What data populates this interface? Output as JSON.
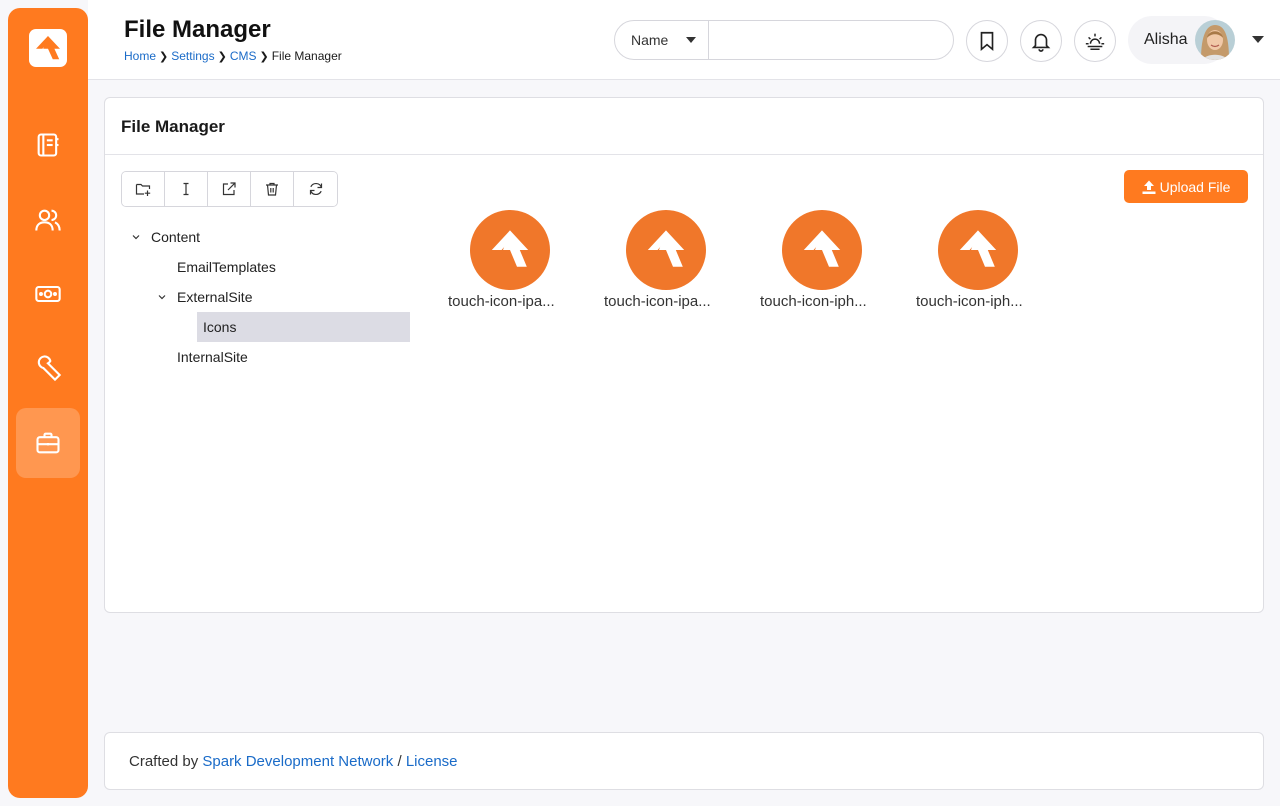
{
  "header": {
    "title": "File Manager",
    "breadcrumb": [
      "Home",
      "Settings",
      "CMS",
      "File Manager"
    ],
    "search": {
      "select_value": "Name",
      "value": "",
      "placeholder": ""
    },
    "user": {
      "name": "Alisha"
    }
  },
  "sidebar": {
    "items": [
      {
        "icon": "book-icon"
      },
      {
        "icon": "people-icon"
      },
      {
        "icon": "money-icon"
      },
      {
        "icon": "wrench-icon"
      },
      {
        "icon": "briefcase-icon",
        "active": true
      }
    ]
  },
  "card": {
    "title": "File Manager",
    "upload_label": "Upload File",
    "toolbar": [
      "new-folder-icon",
      "rename-icon",
      "open-icon",
      "trash-icon",
      "refresh-icon"
    ]
  },
  "tree": {
    "nodes": [
      {
        "label": "Content",
        "expanded": true
      },
      {
        "label": "EmailTemplates"
      },
      {
        "label": "ExternalSite",
        "expanded": true
      },
      {
        "label": "Icons",
        "selected": true
      },
      {
        "label": "InternalSite"
      }
    ]
  },
  "files": [
    {
      "name": "touch-icon-ipa..."
    },
    {
      "name": "touch-icon-ipa..."
    },
    {
      "name": "touch-icon-iph..."
    },
    {
      "name": "touch-icon-iph..."
    }
  ],
  "footer": {
    "prefix": "Crafted by ",
    "link1": "Spark Development Network",
    "sep": " / ",
    "link2": "License"
  },
  "colors": {
    "accent": "#ff7a1f",
    "link": "#1a6bc8"
  }
}
